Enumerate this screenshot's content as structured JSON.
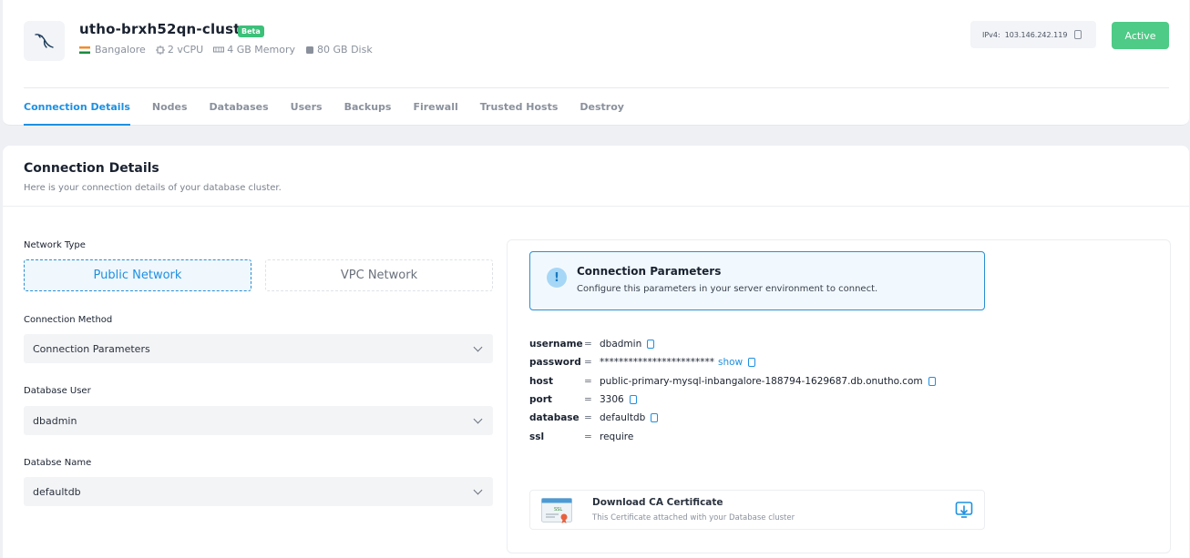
{
  "cluster": {
    "title": "utho-brxh52qn-cluster",
    "badge": "Beta",
    "location": "Bangalore",
    "cpu": "2 vCPU",
    "memory": "4 GB Memory",
    "disk": "80 GB Disk",
    "ipv4_label": "IPv4:",
    "ipv4_value": "103.146.242.119",
    "status": "Active"
  },
  "tabs": [
    {
      "label": "Connection Details",
      "active": true
    },
    {
      "label": "Nodes"
    },
    {
      "label": "Databases"
    },
    {
      "label": "Users"
    },
    {
      "label": "Backups"
    },
    {
      "label": "Firewall"
    },
    {
      "label": "Trusted Hosts"
    },
    {
      "label": "Destroy"
    }
  ],
  "section": {
    "title": "Connection Details",
    "subtitle": "Here is your connection details of your database cluster."
  },
  "form": {
    "network_type_label": "Network Type",
    "network_options": [
      "Public Network",
      "VPC Network"
    ],
    "connection_method_label": "Connection Method",
    "connection_method_value": "Connection Parameters",
    "database_user_label": "Database User",
    "database_user_value": "dbadmin",
    "database_name_label": "Databse Name",
    "database_name_value": "defaultdb"
  },
  "info": {
    "title": "Connection Parameters",
    "subtitle": "Configure this parameters in your server environment to connect.",
    "icon": "!"
  },
  "params": {
    "eq": "=",
    "username_key": "username",
    "username_val": "dbadmin",
    "password_key": "password",
    "password_val": "************************",
    "password_show": "show",
    "host_key": "host",
    "host_val": "public-primary-mysql-inbangalore-188794-1629687.db.onutho.com",
    "port_key": "port",
    "port_val": "3306",
    "database_key": "database",
    "database_val": "defaultdb",
    "ssl_key": "ssl",
    "ssl_val": "require"
  },
  "certificate": {
    "title": "Download CA Certificate",
    "subtitle": "This Certificate attached with your Database cluster",
    "icon_text": "SSL"
  },
  "colors": {
    "accent": "#1e90e0",
    "active": "#4ecb86",
    "beta": "#3cc07a"
  }
}
